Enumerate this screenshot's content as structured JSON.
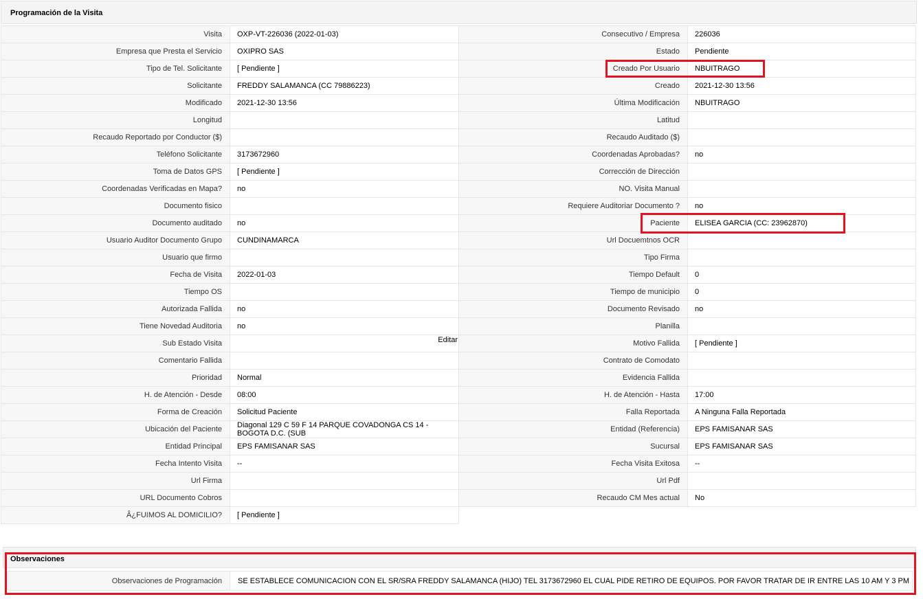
{
  "panel": {
    "title": "Programación de la Visita"
  },
  "rows": [
    {
      "l1": "Visita",
      "v1": "OXP-VT-226036 (2022-01-03)",
      "l2": "Consecutivo / Empresa",
      "v2": "226036"
    },
    {
      "l1": "Empresa que Presta el Servicio",
      "v1": "OXIPRO SAS",
      "l2": "Estado",
      "v2": "Pendiente"
    },
    {
      "l1": "Tipo de Tel. Solicitante",
      "v1": "[ Pendiente ]",
      "l2": "Creado Por Usuario",
      "v2": "NBUITRAGO"
    },
    {
      "l1": "Solicitante",
      "v1": "FREDDY SALAMANCA (CC 79886223)",
      "l2": "Creado",
      "v2": "2021-12-30 13:56"
    },
    {
      "l1": "Modificado",
      "v1": "2021-12-30 13:56",
      "l2": "Última Modificación",
      "v2": " NBUITRAGO"
    },
    {
      "l1": "Longitud",
      "v1": "",
      "l2": "Latitud",
      "v2": ""
    },
    {
      "l1": "Recaudo Reportado por Conductor ($)",
      "v1": "",
      "l2": "Recaudo Auditado ($)",
      "v2": ""
    },
    {
      "l1": "Teléfono Solicitante",
      "v1": "3173672960",
      "l2": "Coordenadas Aprobadas?",
      "v2": " no"
    },
    {
      "l1": "Toma de Datos GPS",
      "v1": "[ Pendiente ]",
      "l2": "Corrección de Dirección",
      "v2": ""
    },
    {
      "l1": "Coordenadas Verificadas en Mapa?",
      "v1": " no",
      "l2": "NO. Visita Manual",
      "v2": ""
    },
    {
      "l1": "Documento fisico",
      "v1": "",
      "l2": "Requiere Auditoriar Documento ?",
      "v2": " no"
    },
    {
      "l1": "Documento auditado",
      "v1": " no",
      "l2": "Paciente",
      "v2": "ELISEA GARCIA (CC: 23962870)"
    },
    {
      "l1": "Usuario Auditor Documento Grupo",
      "v1": "CUNDINAMARCA",
      "l2": "Url Docuemtnos OCR",
      "v2": ""
    },
    {
      "l1": "Usuario que firmo",
      "v1": "",
      "l2": "Tipo Firma",
      "v2": ""
    },
    {
      "l1": "Fecha de Visita",
      "v1": " 2022-01-03",
      "l2": "Tiempo Default",
      "v2": "0"
    },
    {
      "l1": "Tiempo OS",
      "v1": "",
      "l2": "Tiempo de municipio",
      "v2": "0"
    },
    {
      "l1": "Autorizada Fallida",
      "v1": " no",
      "l2": "Documento Revisado",
      "v2": " no"
    },
    {
      "l1": "Tiene Novedad Auditoria",
      "v1": " no",
      "l2": "Planilla",
      "v2": ""
    },
    {
      "l1": "Sub Estado Visita",
      "v1": "",
      "l2": "Motivo Fallida",
      "v2": "[ Pendiente ]"
    },
    {
      "l1": "Comentario Fallida",
      "v1": "",
      "l2": "Contrato de Comodato",
      "v2": ""
    },
    {
      "l1": "Prioridad",
      "v1": "Normal",
      "l2": "Evidencia Fallida",
      "v2": ""
    },
    {
      "l1": "H. de Atención - Desde",
      "v1": "08:00",
      "l2": "H. de Atención - Hasta",
      "v2": "17:00"
    },
    {
      "l1": "Forma de Creación",
      "v1": "Solicitud Paciente",
      "l2": "Falla Reportada",
      "v2": "A Ninguna Falla Reportada"
    },
    {
      "l1": "Ubicación del Paciente",
      "v1": "Diagonal 129 C 59 F 14 PARQUE COVADONGA CS 14 - BOGOTA D.C. (SUB",
      "l2": "Entidad (Referencia)",
      "v2": "EPS FAMISANAR SAS"
    },
    {
      "l1": "Entidad Principal",
      "v1": "EPS FAMISANAR SAS",
      "l2": "Sucursal",
      "v2": "EPS FAMISANAR SAS"
    },
    {
      "l1": "Fecha Intento Visita",
      "v1": " --",
      "l2": "Fecha Visita Exitosa",
      "v2": " --"
    },
    {
      "l1": "Url Firma",
      "v1": "",
      "l2": "Url Pdf",
      "v2": ""
    },
    {
      "l1": "URL Documento Cobros",
      "v1": "",
      "l2": "Recaudo CM Mes actual",
      "v2": "No"
    },
    {
      "l1": "Â¿FUIMOS AL DOMICILIO?",
      "v1": "[ Pendiente ]"
    }
  ],
  "sub_estado_action": "Editar",
  "observaciones": {
    "title": "Observaciones",
    "label": "Observaciones de Programación",
    "value": "SE ESTABLECE COMUNICACION CON EL SR/SRA FREDDY SALAMANCA (HIJO) TEL 3173672960 EL CUAL PIDE RETIRO DE EQUIPOS. POR FAVOR TRATAR DE IR ENTRE LAS 10 AM Y 3 PM"
  },
  "highlight_color": "#e3141e"
}
